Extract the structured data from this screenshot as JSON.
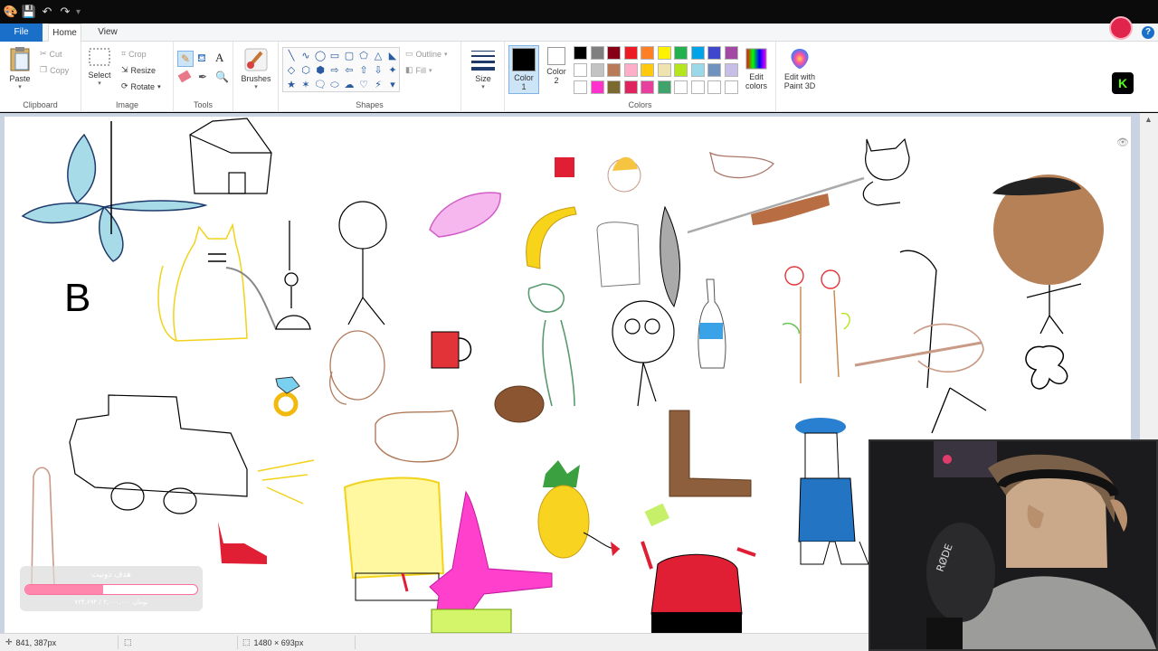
{
  "menu": {
    "file": "File",
    "home": "Home",
    "view": "View",
    "help": "?"
  },
  "ribbon": {
    "clipboard": {
      "label": "Clipboard",
      "paste": "Paste",
      "cut": "Cut",
      "copy": "Copy"
    },
    "image": {
      "label": "Image",
      "select": "Select",
      "crop": "Crop",
      "resize": "Resize",
      "rotate": "Rotate"
    },
    "tools": {
      "label": "Tools"
    },
    "brushes": {
      "label": "Brushes"
    },
    "shapes": {
      "label": "Shapes",
      "outline": "Outline",
      "fill": "Fill"
    },
    "size": {
      "label": "Size"
    },
    "colors": {
      "label": "Colors",
      "color1": "Color 1",
      "color2": "Color 2",
      "color1_value": "#000000",
      "color2_value": "#ffffff",
      "edit_colors": "Edit colors",
      "palette_row1": [
        "#000000",
        "#7f7f7f",
        "#880015",
        "#ed1c24",
        "#ff7f27",
        "#fff200",
        "#22b14c",
        "#00a2e8",
        "#3f48cc",
        "#a349a4"
      ],
      "palette_row2": [
        "#ffffff",
        "#c3c3c3",
        "#b97a57",
        "#ffaec9",
        "#ffc90e",
        "#efe4b0",
        "#b5e61d",
        "#99d9ea",
        "#7092be",
        "#c8bfe7"
      ],
      "palette_row3": [
        "#ffffff",
        "#ff33cc",
        "#7a6a30",
        "#e0245e",
        "#e83e9e",
        "#3fa36b",
        "#ffffff",
        "#ffffff",
        "#ffffff",
        "#ffffff"
      ]
    },
    "paint3d": {
      "label": "Edit with Paint 3D"
    }
  },
  "status": {
    "cursor": "841, 387px",
    "dimensions": "1480 × 693px"
  },
  "donation": {
    "title": "هدف دونیت",
    "percent_text": "%۴۵",
    "progress": 0.45,
    "subtitle": "۷۲۴,۶۹۴ / ۳,۰۰۰,۰۰۰ تومان"
  },
  "canvas": {
    "letter": "B"
  },
  "webcam": {
    "mic_brand": "RØDE"
  }
}
